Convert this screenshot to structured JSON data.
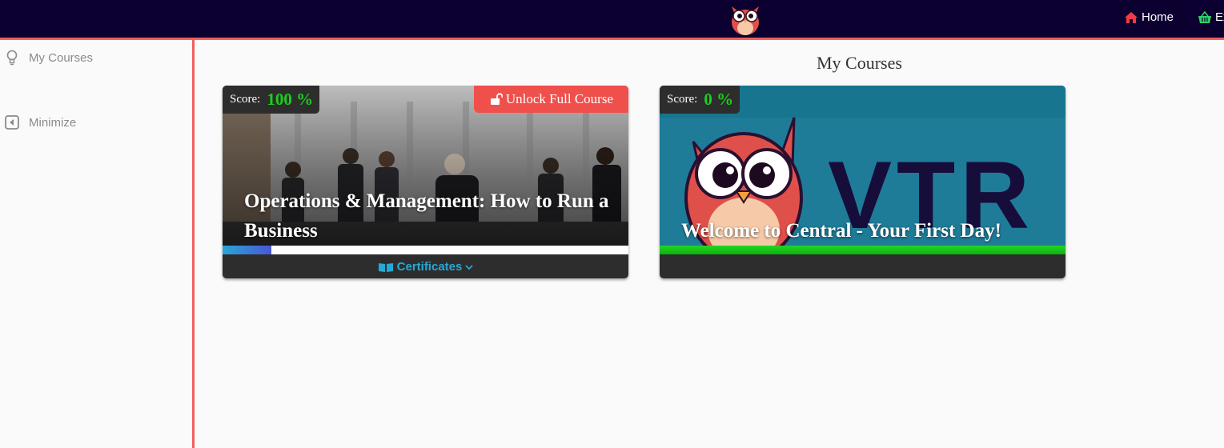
{
  "header": {
    "nav": {
      "home_label": "Home",
      "ex_label": "Ex"
    }
  },
  "sidebar": {
    "items": [
      {
        "label": "My Courses",
        "icon": "lightbulb-icon"
      },
      {
        "label": "Minimize",
        "icon": "collapse-left-icon"
      }
    ]
  },
  "main": {
    "title": "My Courses",
    "courses": [
      {
        "score_label": "Score:",
        "score_value": "100 %",
        "unlock_label": "Unlock Full Course",
        "title_line1": "Operations & Management: How to Run a",
        "title_line2": "Business",
        "progress": 0.12,
        "certificates_label": "Certificates"
      },
      {
        "score_label": "Score:",
        "score_value": "0 %",
        "banner_text": "VTR",
        "title": "Welcome to Central - Your First Day!",
        "progress": 1.0
      }
    ]
  },
  "colors": {
    "topbar": "#0c0030",
    "accent": "#f0605c",
    "score_green": "#1bcf1b",
    "cert_blue": "#26a9d6"
  }
}
